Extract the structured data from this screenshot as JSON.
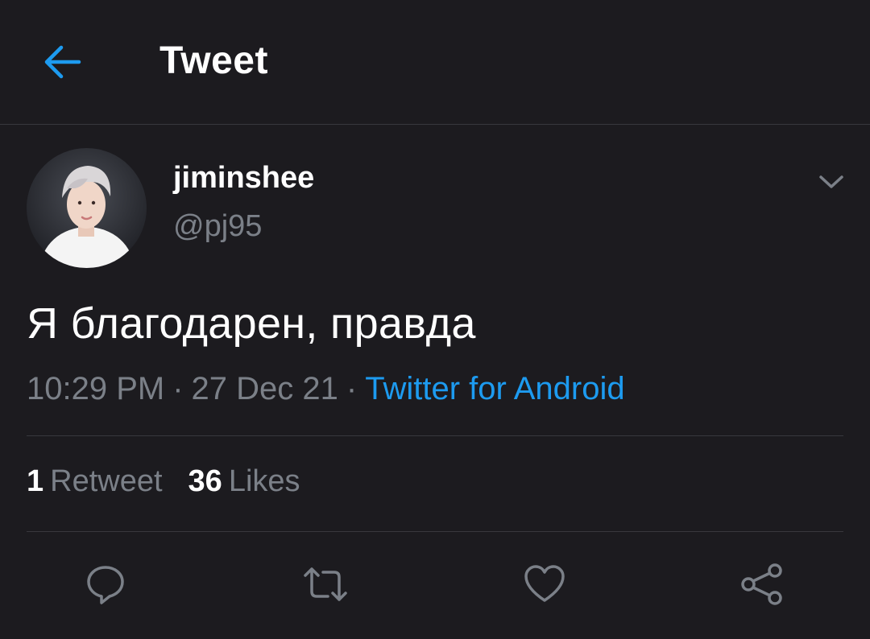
{
  "header": {
    "title": "Tweet",
    "back_icon": "arrow-left-icon"
  },
  "tweet": {
    "display_name": "jiminshee",
    "handle": "@pj95",
    "text": "Я благодарен, правда",
    "time": "10:29 PM",
    "date": "27 Dec 21",
    "separator": "·",
    "source": "Twitter for Android"
  },
  "stats": {
    "retweets_count": "1",
    "retweets_label": "Retweet",
    "likes_count": "36",
    "likes_label": "Likes"
  },
  "actions": [
    "reply-icon",
    "retweet-icon",
    "like-icon",
    "share-icon"
  ],
  "colors": {
    "background": "#1c1b1f",
    "accent": "#1d9bf0",
    "secondary_text": "#7b8088",
    "divider": "#38383d"
  }
}
